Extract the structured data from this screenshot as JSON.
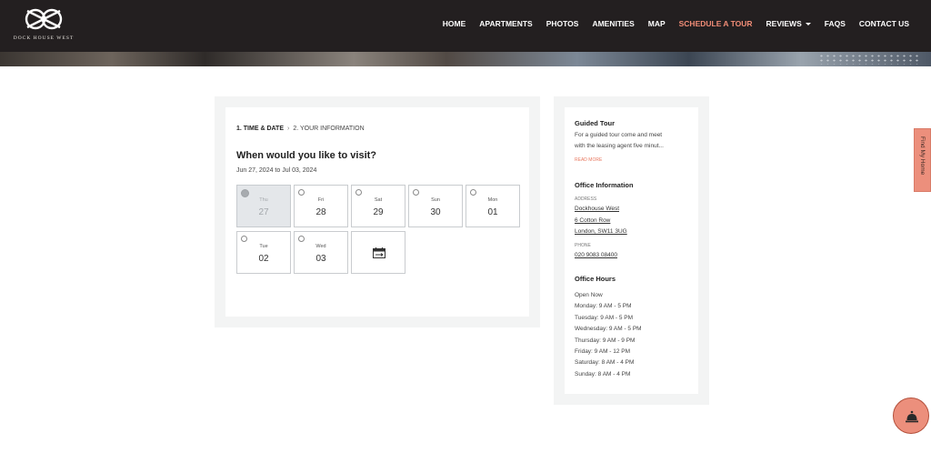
{
  "brand": {
    "name": "DOCK HOUSE WEST"
  },
  "nav": {
    "items": [
      {
        "label": "HOME",
        "active": false
      },
      {
        "label": "APARTMENTS",
        "active": false
      },
      {
        "label": "PHOTOS",
        "active": false
      },
      {
        "label": "AMENITIES",
        "active": false
      },
      {
        "label": "MAP",
        "active": false
      },
      {
        "label": "SCHEDULE A TOUR",
        "active": true
      },
      {
        "label": "REVIEWS",
        "active": false,
        "dropdown": true
      },
      {
        "label": "FAQS",
        "active": false
      },
      {
        "label": "CONTACT US",
        "active": false
      }
    ]
  },
  "booking": {
    "step1": "1. TIME & DATE",
    "step2": "2. YOUR INFORMATION",
    "question": "When would you like to visit?",
    "date_range": "Jun 27, 2024 to Jul 03, 2024",
    "days": [
      {
        "dow": "Thu",
        "num": "27",
        "disabled": true
      },
      {
        "dow": "Fri",
        "num": "28",
        "disabled": false
      },
      {
        "dow": "Sat",
        "num": "29",
        "disabled": false
      },
      {
        "dow": "Sun",
        "num": "30",
        "disabled": false
      },
      {
        "dow": "Mon",
        "num": "01",
        "disabled": false
      },
      {
        "dow": "Tue",
        "num": "02",
        "disabled": false
      },
      {
        "dow": "Wed",
        "num": "03",
        "disabled": false
      }
    ],
    "calendar_icon": "calendar-icon"
  },
  "sidebar": {
    "guided_tour": {
      "title": "Guided Tour",
      "line1": "For a guided tour come and meet",
      "line2": "with the leasing agent five minut...",
      "read_more": "READ MORE"
    },
    "office": {
      "title": "Office Information",
      "address_label": "ADDRESS",
      "address": [
        "Dockhouse West",
        "6 Cotton Row",
        "London, SW11 3UG"
      ],
      "phone_label": "PHONE",
      "phone": "020 9083 08400"
    },
    "hours": {
      "title": "Office Hours",
      "lines": [
        "Open Now",
        "Monday: 9 AM - 5 PM",
        "Tuesday: 9 AM - 5 PM",
        "Wednesday: 9 AM - 5 PM",
        "Thursday: 9 AM - 9 PM",
        "Friday: 9 AM - 12 PM",
        "Saturday: 8 AM - 4 PM",
        "Sunday: 8 AM - 4 PM"
      ]
    }
  },
  "side_tab": {
    "label": "Find My Home"
  },
  "fab": {
    "icon": "concierge-bell-icon"
  },
  "colors": {
    "header_bg": "#231f20",
    "accent": "#ec8f7c",
    "active_nav": "#f28d77"
  }
}
